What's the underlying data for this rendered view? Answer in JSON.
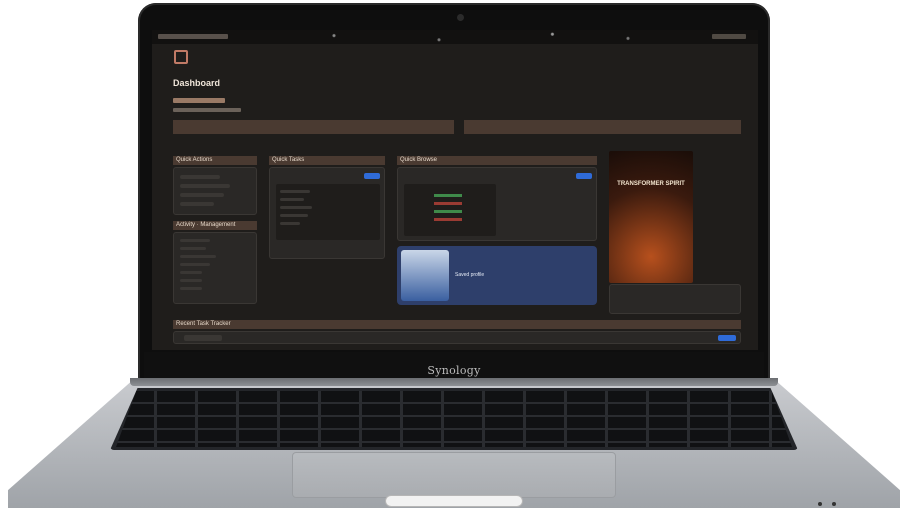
{
  "device": {
    "brand": "Synology"
  },
  "screen": {
    "topbar": {
      "left_text": "",
      "right_text": ""
    },
    "page_title": "Dashboard",
    "sections": {
      "quick_actions": "Quick Actions",
      "activity": "Activity · Management",
      "quick_tasks": "Quick Tasks",
      "quick_browse": "Quick Browse",
      "recent_tasks": "Recent Task Tracker"
    },
    "hero_title": "TRANSFORMER SPIRIT",
    "profile_card": {
      "caption": "Saved profile",
      "detail": ""
    },
    "colors": {
      "accent": "#4a3a31",
      "blue": "#2f6bd8",
      "card_blue": "#2e3f6b"
    }
  }
}
